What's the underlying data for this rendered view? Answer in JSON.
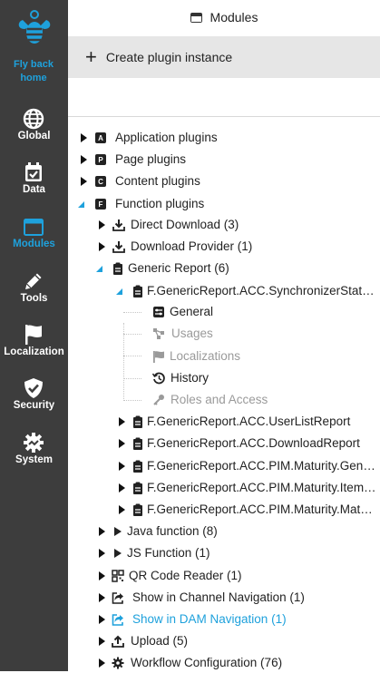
{
  "sidebar": {
    "logo_label": "Fly back home",
    "items": [
      {
        "label": "Global",
        "icon": "globe-icon"
      },
      {
        "label": "Data",
        "icon": "calendar-check-icon"
      },
      {
        "label": "Modules",
        "icon": "window-icon"
      },
      {
        "label": "Tools",
        "icon": "pencil-icon"
      },
      {
        "label": "Localization",
        "icon": "flag-icon"
      },
      {
        "label": "Security",
        "icon": "shield-check-icon"
      },
      {
        "label": "System",
        "icon": "gear-icon"
      }
    ],
    "active_color": "#1ea1dc",
    "background": "#3d3d3d"
  },
  "header": {
    "title": "Modules",
    "icon": "window-icon"
  },
  "toolbar": {
    "create_label": "Create plugin instance",
    "icon": "plus-icon"
  },
  "tree": [
    {
      "label": "Application plugins",
      "icon": "box-a-icon",
      "state": "collapsed"
    },
    {
      "label": "Page plugins",
      "icon": "box-p-icon",
      "state": "collapsed"
    },
    {
      "label": "Content plugins",
      "icon": "box-c-icon",
      "state": "collapsed"
    },
    {
      "label": "Function plugins",
      "icon": "box-f-icon",
      "state": "expanded"
    },
    {
      "label": "Direct Download (3)",
      "icon": "download-icon",
      "state": "collapsed"
    },
    {
      "label": "Download Provider (1)",
      "icon": "download-icon",
      "state": "collapsed"
    },
    {
      "label": "Generic Report (6)",
      "icon": "clipboard-icon",
      "state": "expanded"
    },
    {
      "label": "F.GenericReport.ACC.SynchronizerStat…",
      "icon": "clipboard-icon",
      "state": "expanded"
    },
    {
      "label": "General",
      "icon": "sliders-icon",
      "state": "leaf"
    },
    {
      "label": "Usages",
      "icon": "share-nodes-icon",
      "state": "leaf-disabled"
    },
    {
      "label": "Localizations",
      "icon": "flag-icon",
      "state": "leaf-disabled"
    },
    {
      "label": "History",
      "icon": "history-icon",
      "state": "leaf"
    },
    {
      "label": "Roles and Access",
      "icon": "key-icon",
      "state": "leaf-disabled"
    },
    {
      "label": "F.GenericReport.ACC.UserListReport",
      "icon": "clipboard-icon",
      "state": "collapsed"
    },
    {
      "label": "F.GenericReport.ACC.DownloadReport",
      "icon": "clipboard-icon",
      "state": "collapsed"
    },
    {
      "label": "F.GenericReport.ACC.PIM.Maturity.Gen…",
      "icon": "clipboard-icon",
      "state": "collapsed"
    },
    {
      "label": "F.GenericReport.ACC.PIM.Maturity.Item…",
      "icon": "clipboard-icon",
      "state": "collapsed"
    },
    {
      "label": "F.GenericReport.ACC.PIM.Maturity.Mat…",
      "icon": "clipboard-icon",
      "state": "collapsed"
    },
    {
      "label": "Java function (8)",
      "icon": "play-icon",
      "state": "collapsed"
    },
    {
      "label": "JS Function (1)",
      "icon": "play-icon",
      "state": "collapsed"
    },
    {
      "label": "QR Code Reader (1)",
      "icon": "qrcode-icon",
      "state": "collapsed"
    },
    {
      "label": "Show in Channel Navigation (1)",
      "icon": "share-square-icon",
      "state": "collapsed"
    },
    {
      "label": "Show in DAM Navigation (1)",
      "icon": "share-square-icon",
      "state": "collapsed-link"
    },
    {
      "label": "Upload (5)",
      "icon": "upload-icon",
      "state": "collapsed"
    },
    {
      "label": "Workflow Configuration (76)",
      "icon": "gear-icon",
      "state": "collapsed"
    }
  ]
}
